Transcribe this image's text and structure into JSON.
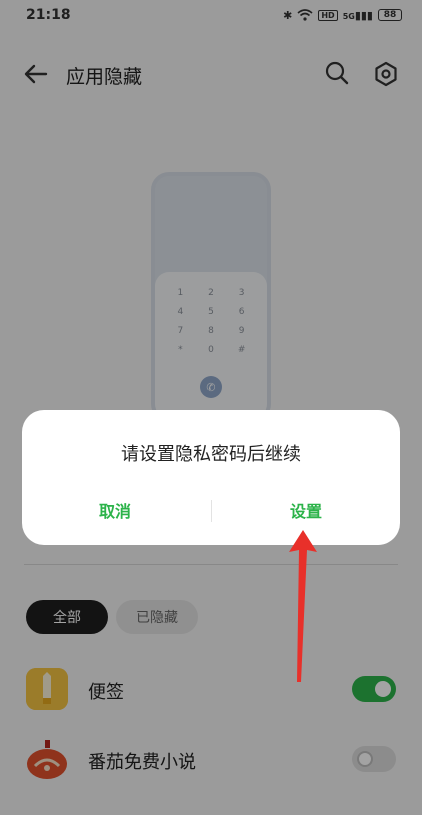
{
  "status_bar": {
    "time": "21:18",
    "icons": [
      "bluetooth-icon",
      "wifi-icon",
      "hd-icon",
      "5g-signal-icon",
      "battery-icon"
    ],
    "hd_label": "HD",
    "network_label": "5G",
    "battery": "88"
  },
  "header": {
    "title": "应用隐藏",
    "back_icon": "back-arrow-icon",
    "search_icon": "search-icon",
    "settings_icon": "settings-icon"
  },
  "illustration": {
    "keys": [
      "1",
      "2",
      "3",
      "4",
      "5",
      "6",
      "7",
      "8",
      "9",
      "*",
      "0",
      "#"
    ],
    "call_icon": "phone-icon"
  },
  "filters": {
    "all_label": "全部",
    "hidden_label": "已隐藏",
    "selected": "全部"
  },
  "apps": [
    {
      "name": "便签",
      "icon": "notes-app-icon",
      "enabled": true
    },
    {
      "name": "番茄免费小说",
      "icon": "novel-app-icon",
      "enabled": false
    }
  ],
  "dialog": {
    "message": "请设置隐私密码后继续",
    "cancel_label": "取消",
    "confirm_label": "设置"
  },
  "colors": {
    "accent": "#2cb34a",
    "annotation_arrow": "#e8302a",
    "overlay": "rgba(0,0,0,0.36)"
  }
}
